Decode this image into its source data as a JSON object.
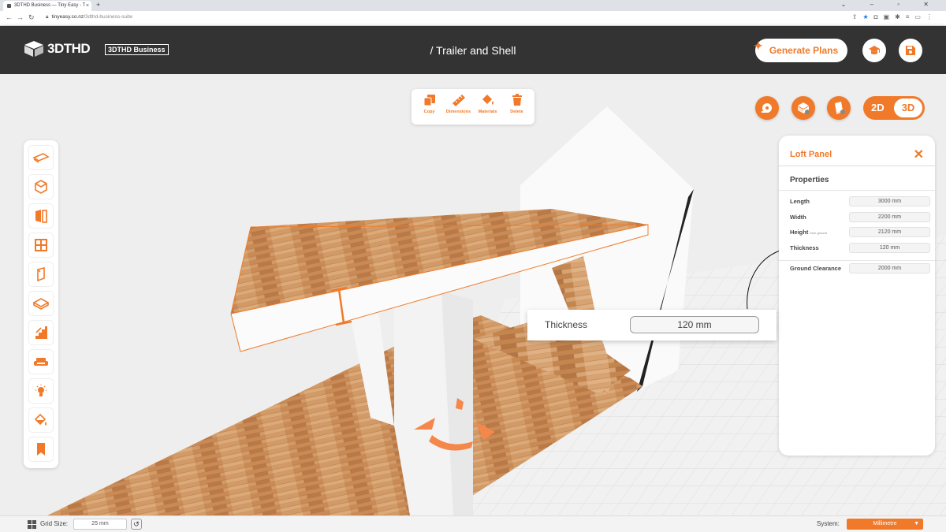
{
  "browser": {
    "tab_title": "3DTHD Business — Tiny Easy - T",
    "tab_close": "×",
    "new_tab": "+",
    "window_controls": "⌄ – ▫ ✕",
    "url_host": "tinyeasy.co.nz",
    "url_path": "/3dthd-business-suite"
  },
  "header": {
    "logo_text": "3DTHD",
    "badge_text": "3DTHD Business",
    "page_title": "/ Trailer and Shell",
    "generate_button": "Generate Plans"
  },
  "toolbar": {
    "items": [
      {
        "label": "Copy",
        "icon": "copy-icon"
      },
      {
        "label": "Dimensions",
        "icon": "ruler-icon"
      },
      {
        "label": "Materials",
        "icon": "paint-bucket-icon"
      },
      {
        "label": "Delete",
        "icon": "trash-icon"
      }
    ]
  },
  "view_toggle": {
    "option_2d": "2D",
    "option_3d": "3D",
    "selected": "3D"
  },
  "left_toolbar": [
    "trailer-icon",
    "shell-icon",
    "door-icon",
    "window-icon",
    "wall-panel-icon",
    "loft-icon",
    "stairs-icon",
    "furniture-icon",
    "lighting-icon",
    "materials-icon",
    "bookmark-icon"
  ],
  "panel": {
    "title": "Loft Panel",
    "close": "✕",
    "section": "Properties",
    "properties": [
      {
        "label": "Length",
        "note": "",
        "value": "3000 mm"
      },
      {
        "label": "Width",
        "note": "",
        "value": "2200 mm"
      },
      {
        "label": "Height",
        "note": "from ground",
        "value": "2120 mm"
      },
      {
        "label": "Thickness",
        "note": "",
        "value": "120 mm"
      },
      {
        "label": "Ground Clearance",
        "note": "",
        "value": "2000 mm"
      }
    ]
  },
  "callout": {
    "label": "Thickness",
    "value": "120 mm"
  },
  "bottom_bar": {
    "grid_label": "Grid Size:",
    "grid_value": "25 mm",
    "reset": "↺",
    "system_label": "System:",
    "system_value": "Millimetre"
  },
  "colors": {
    "accent": "#f07a2a",
    "header": "#333333",
    "wood": "#c98a55"
  }
}
